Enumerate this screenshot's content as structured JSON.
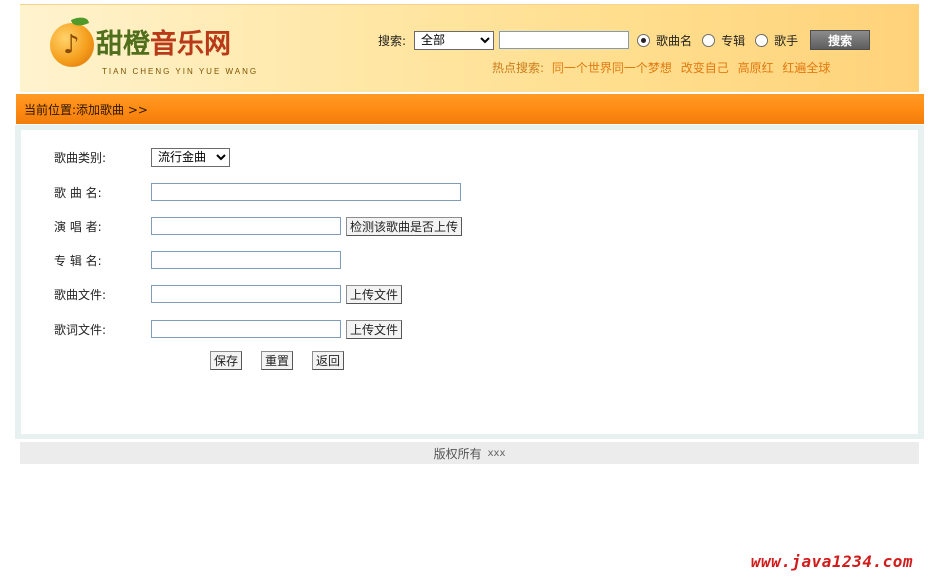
{
  "header": {
    "logo": {
      "title_part1": "甜橙",
      "title_part2": "音乐网",
      "subtitle": "TIAN CHENG YIN YUE WANG",
      "colors": {
        "primary": "#4f6f1d",
        "secondary": "#b83a19",
        "fruit": "#f59f1d"
      }
    },
    "search": {
      "label": "搜索:",
      "scope_selected": "全部",
      "query_value": "",
      "options": [
        {
          "label": "歌曲名",
          "checked": true
        },
        {
          "label": "专辑",
          "checked": false
        },
        {
          "label": "歌手",
          "checked": false
        }
      ],
      "button_label": "搜索"
    },
    "hot": {
      "label": "热点搜索:",
      "links": [
        "同一个世界同一个梦想",
        "改变自己",
        "高原红",
        "红遍全球"
      ]
    }
  },
  "breadcrumb": {
    "text": "当前位置:添加歌曲 >>"
  },
  "form": {
    "category": {
      "label": "歌曲类别:",
      "selected": "流行金曲"
    },
    "song_name": {
      "label": "歌 曲 名:",
      "value": ""
    },
    "singer": {
      "label": "演 唱 者:",
      "value": "",
      "check_button": "检测该歌曲是否上传"
    },
    "album": {
      "label": "专 辑 名:",
      "value": ""
    },
    "song_file": {
      "label": "歌曲文件:",
      "value": "",
      "upload_button": "上传文件"
    },
    "lyric_file": {
      "label": "歌词文件:",
      "value": "",
      "upload_button": "上传文件"
    },
    "actions": {
      "save": "保存",
      "reset": "重置",
      "back": "返回"
    }
  },
  "footer": {
    "text": "版权所有",
    "owner": "xxx"
  },
  "watermark": "www.java1234.com",
  "colors": {
    "bar": "#ff8a12",
    "hot_link": "#e07a12",
    "panel_border": "#e7f1ef",
    "watermark": "#d21c1c"
  }
}
